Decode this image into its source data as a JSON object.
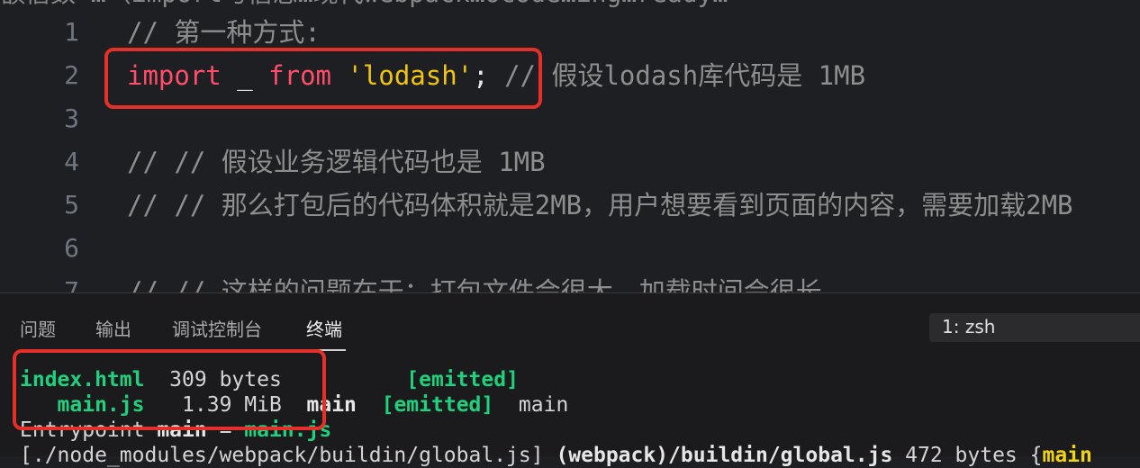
{
  "editor": {
    "top_partial_text": "额信数 …（import与信息…现代webpack…ocode…ing…ready…",
    "lines": [
      {
        "num": "1",
        "comment": "// 第一种方式:"
      },
      {
        "num": "2",
        "kw1": "import",
        "ident": " _ ",
        "kw2": "from",
        "sp": " ",
        "str": "'lodash'",
        "semi": ";",
        "comment": " // 假设lodash库代码是 1MB"
      },
      {
        "num": "3"
      },
      {
        "num": "4",
        "comment": "// // 假设业务逻辑代码也是 1MB"
      },
      {
        "num": "5",
        "comment": "// // 那么打包后的代码体积就是2MB，用户想要看到页面的内容，需要加载2MB"
      },
      {
        "num": "6"
      },
      {
        "num": "7",
        "comment": "// // 这样的问题在于：打包文件会很大，加载时间会很长"
      }
    ]
  },
  "panel": {
    "tabs": [
      "问题",
      "输出",
      "调试控制台",
      "终端"
    ],
    "active_tab": "终端",
    "terminal_select": "1: zsh",
    "terminal": {
      "row1": {
        "asset": "index.html",
        "size": "  309 bytes",
        "pad": "          ",
        "status": "[emitted]"
      },
      "row2": {
        "asset": "   main.js",
        "size": "   1.39 MiB",
        "pad": "  ",
        "chunk": "main",
        "pad2": "  ",
        "status": "[emitted]",
        "names": "  main"
      },
      "row3": {
        "label": "Entrypoint ",
        "name": "main",
        "eq": " = ",
        "file": "main.js"
      },
      "row4": {
        "path": "[./node_modules/webpack/buildin/global.js] ",
        "bold": "(webpack)/buildin/global.js",
        "size": " 472 bytes {",
        "chunk": "main"
      }
    }
  },
  "colors": {
    "keyword": "#ff4d6a",
    "string": "#f1c40f",
    "terminal_green": "#1fd17c",
    "highlight_border": "#e5302a"
  }
}
